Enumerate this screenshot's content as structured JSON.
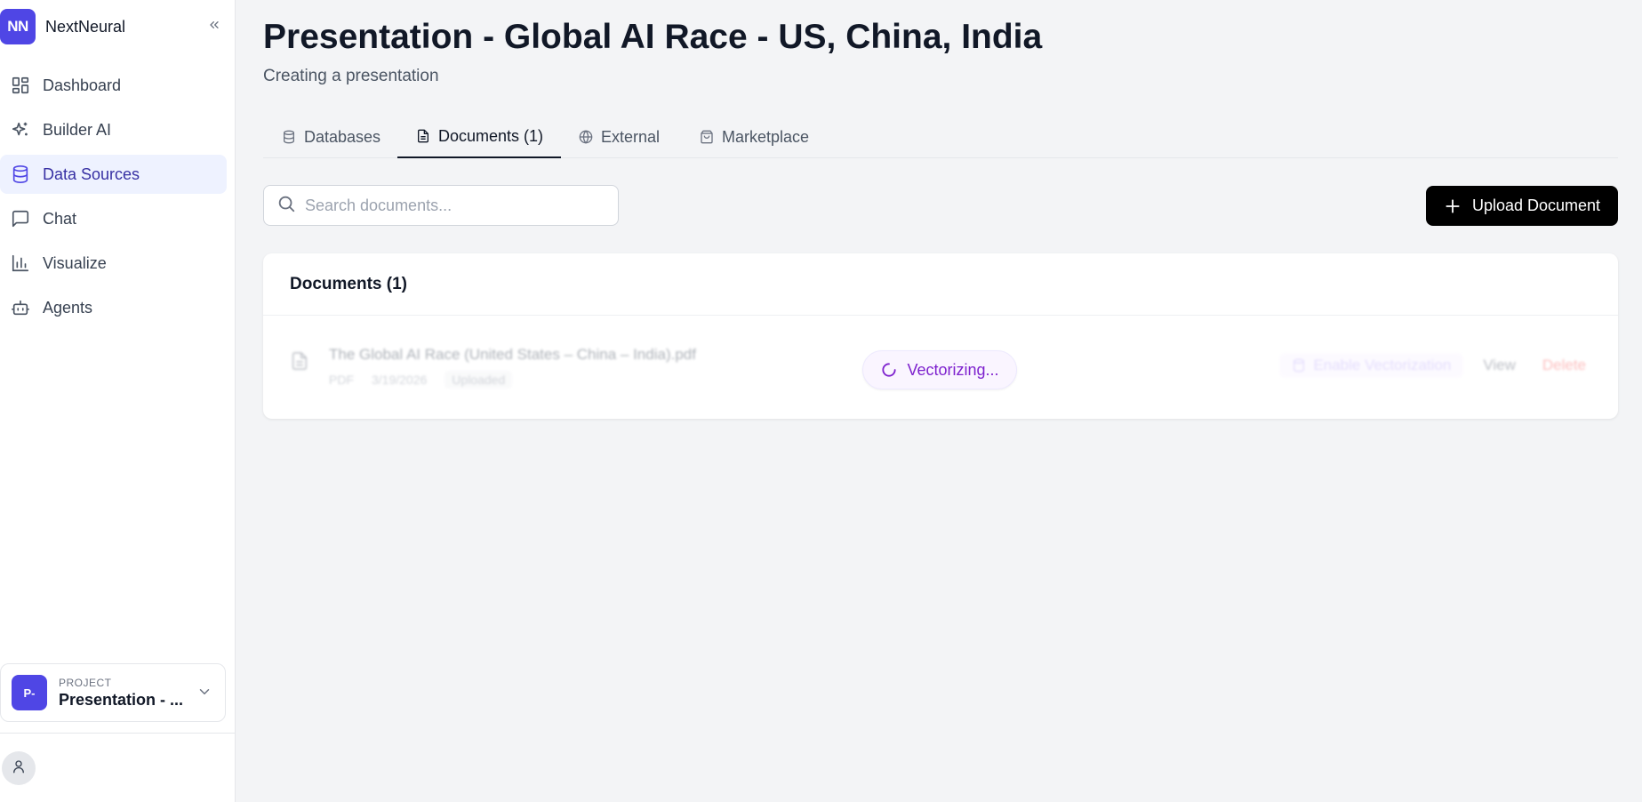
{
  "brand": {
    "logo_text": "NN",
    "name": "NextNeural"
  },
  "sidebar": {
    "items": [
      {
        "label": "Dashboard",
        "icon": "dashboard-icon"
      },
      {
        "label": "Builder AI",
        "icon": "sparkles-icon"
      },
      {
        "label": "Data Sources",
        "icon": "database-icon",
        "active": true
      },
      {
        "label": "Chat",
        "icon": "message-square-icon"
      },
      {
        "label": "Visualize",
        "icon": "bar-chart-icon"
      },
      {
        "label": "Agents",
        "icon": "bot-icon"
      }
    ],
    "project": {
      "avatar_text": "P-",
      "caption": "PROJECT",
      "name": "Presentation - ..."
    }
  },
  "page": {
    "title": "Presentation - Global AI Race - US, China, India",
    "subtitle": "Creating a presentation"
  },
  "tabs": [
    {
      "label": "Databases",
      "icon": "database-icon"
    },
    {
      "label": "Documents (1)",
      "icon": "file-text-icon",
      "active": true
    },
    {
      "label": "External",
      "icon": "globe-icon"
    },
    {
      "label": "Marketplace",
      "icon": "shopping-bag-icon"
    }
  ],
  "search": {
    "placeholder": "Search documents...",
    "value": ""
  },
  "toolbar": {
    "upload_label": "Upload Document"
  },
  "documents": {
    "header": "Documents (1)",
    "rows": [
      {
        "name": "The Global AI Race (United States – China – India).pdf",
        "type": "PDF",
        "date": "3/19/2026",
        "badge": "Uploaded",
        "status": "Vectorizing...",
        "enable_label": "Enable Vectorization",
        "view_label": "View",
        "delete_label": "Delete"
      }
    ]
  },
  "colors": {
    "accent": "#4f46e5",
    "status_purple": "#7e22ce",
    "delete_red": "#f87171",
    "primary_button": "#000000"
  }
}
